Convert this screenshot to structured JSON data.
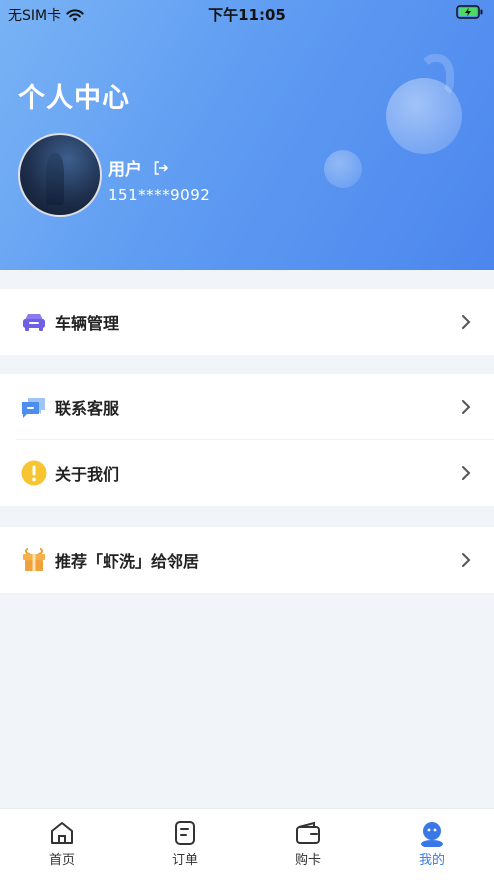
{
  "status": {
    "carrier": "无SIM卡",
    "time": "下午11:05"
  },
  "header": {
    "title": "个人中心",
    "username": "用户",
    "phone": "151****9092"
  },
  "menu": {
    "vehicle": "车辆管理",
    "contact": "联系客服",
    "about": "关于我们",
    "recommend": "推荐「虾洗」给邻居"
  },
  "tabs": [
    {
      "label": "首页",
      "icon": "home-icon"
    },
    {
      "label": "订单",
      "icon": "order-icon"
    },
    {
      "label": "购卡",
      "icon": "wallet-icon"
    },
    {
      "label": "我的",
      "icon": "profile-icon",
      "active": true
    }
  ],
  "colors": {
    "accent": "#3a78e7",
    "header_start": "#79b3f5",
    "header_end": "#4c86ee"
  }
}
